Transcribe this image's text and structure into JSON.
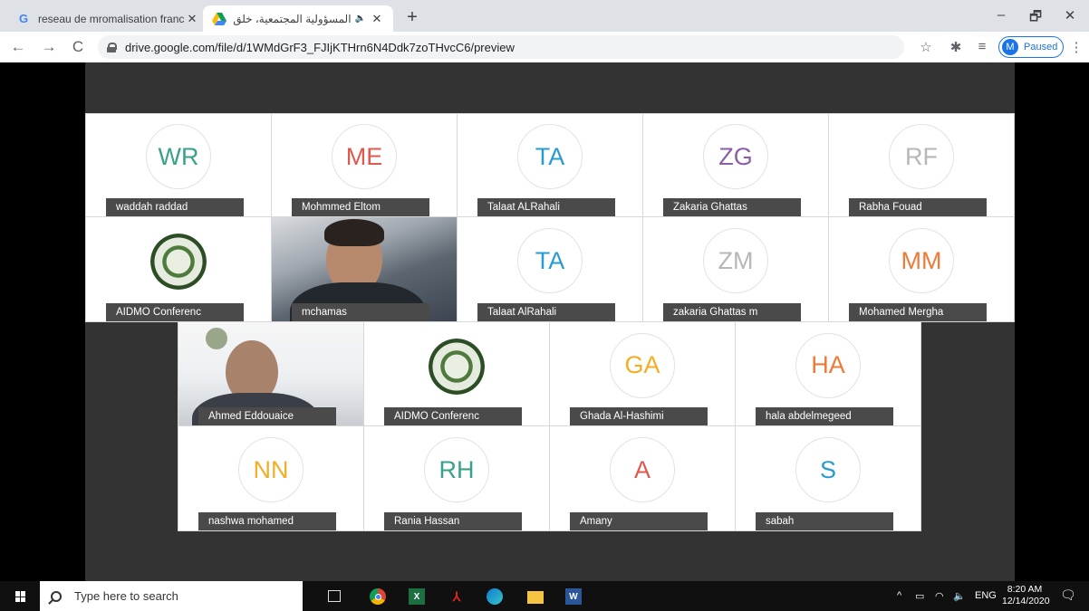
{
  "browser": {
    "tabs": [
      {
        "title": "reseau de mromalisation francop",
        "favicon": "google-icon"
      },
      {
        "title": "المسؤولية المجتمعية، خلق قيم",
        "favicon": "drive-icon"
      }
    ],
    "new_tab": "+",
    "window_controls": {
      "minimize": "–",
      "restore": "🗗",
      "close": "✕"
    },
    "url": "drive.google.com/file/d/1WMdGrF3_FJIjKTHrn6N4Ddk7zoTHvcC6/preview",
    "profile": {
      "initial": "M",
      "status": "Paused"
    }
  },
  "gallery": {
    "participants": [
      {
        "name": "waddah raddad",
        "initials": "WR",
        "color": "#3aa18a"
      },
      {
        "name": "Mohmmed Eltom",
        "initials": "ME",
        "color": "#e0594f"
      },
      {
        "name": "Talaat ALRahali",
        "initials": "TA",
        "color": "#2a9bd0"
      },
      {
        "name": "Zakaria Ghattas",
        "initials": "ZG",
        "color": "#8a5ea8"
      },
      {
        "name": "Rabha Fouad",
        "initials": "RF",
        "color": "#b7b7b7"
      },
      {
        "name": "AIDMO Conferenc",
        "initials": "",
        "color": ""
      },
      {
        "name": "mchamas",
        "initials": "",
        "color": ""
      },
      {
        "name": "Talaat AlRahali",
        "initials": "TA",
        "color": "#2a9bd0"
      },
      {
        "name": "zakaria Ghattas m",
        "initials": "ZM",
        "color": "#b7b7b7"
      },
      {
        "name": "Mohamed Mergha",
        "initials": "MM",
        "color": "#f07a37"
      },
      {
        "name": "Ahmed Eddouaice",
        "initials": "",
        "color": ""
      },
      {
        "name": "AIDMO Conferenc",
        "initials": "",
        "color": ""
      },
      {
        "name": "Ghada Al-Hashimi",
        "initials": "GA",
        "color": "#f2ae25"
      },
      {
        "name": "hala abdelmegeed",
        "initials": "HA",
        "color": "#f07a37"
      },
      {
        "name": "nashwa mohamed",
        "initials": "NN",
        "color": "#f2ae25"
      },
      {
        "name": "Rania Hassan",
        "initials": "RH",
        "color": "#3aa18a"
      },
      {
        "name": "Amany",
        "initials": "A",
        "color": "#e0594f"
      },
      {
        "name": "sabah",
        "initials": "S",
        "color": "#2a9bd0"
      }
    ]
  },
  "taskbar": {
    "search_placeholder": "Type here to search",
    "apps": [
      "task-view-icon",
      "chrome-icon",
      "excel-icon",
      "acrobat-icon",
      "edge-icon",
      "file-explorer-icon",
      "word-icon"
    ],
    "language": "ENG",
    "time": "8:20 AM",
    "date": "12/14/2020"
  }
}
